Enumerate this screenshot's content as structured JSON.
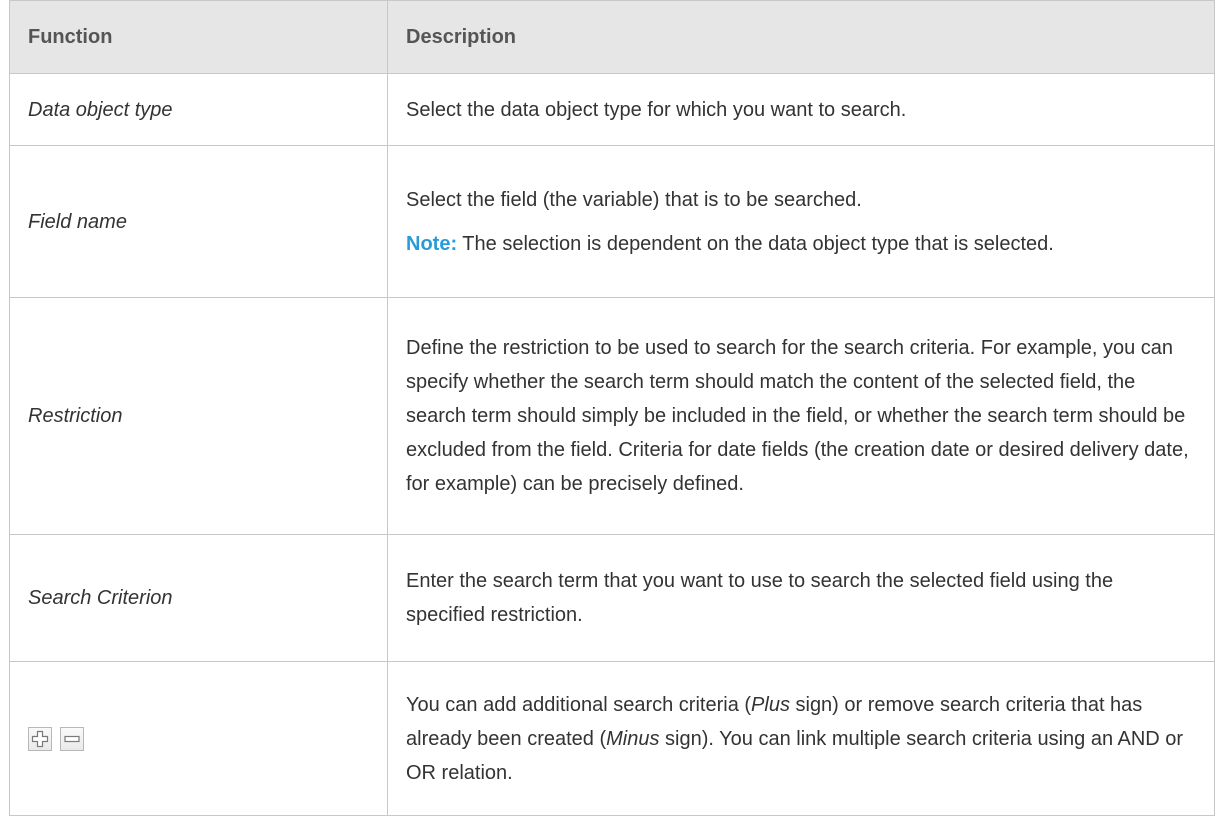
{
  "table": {
    "headers": [
      "Function",
      "Description"
    ],
    "rows": [
      {
        "function": "Data object type",
        "description": "Select the data object type for which you want to search."
      },
      {
        "function": "Field name",
        "description": "Select the field (the variable) that is to be searched.",
        "note_label": "Note:",
        "note_text": " The selection is dependent on the data object type that is selected."
      },
      {
        "function": "Restriction",
        "description": "Define the restriction to be used to search for the search criteria. For example, you can specify whether the search term should match the content of the selected field, the search term should simply be included in the field, or whether the search term should be excluded from the field. Criteria for date fields (the creation date or desired delivery date, for example) can be precisely defined."
      },
      {
        "function": "Search Criterion",
        "description": "Enter the search term that you want to use to search the selected field using the specified restriction."
      },
      {
        "function_icons": [
          "plus-icon",
          "minus-icon"
        ],
        "description_parts": [
          "You can add additional search criteria (",
          "Plus",
          " sign) or remove search criteria that has already been created (",
          "Minus",
          " sign). You can link multiple search criteria using an AND or OR relation."
        ]
      }
    ]
  }
}
